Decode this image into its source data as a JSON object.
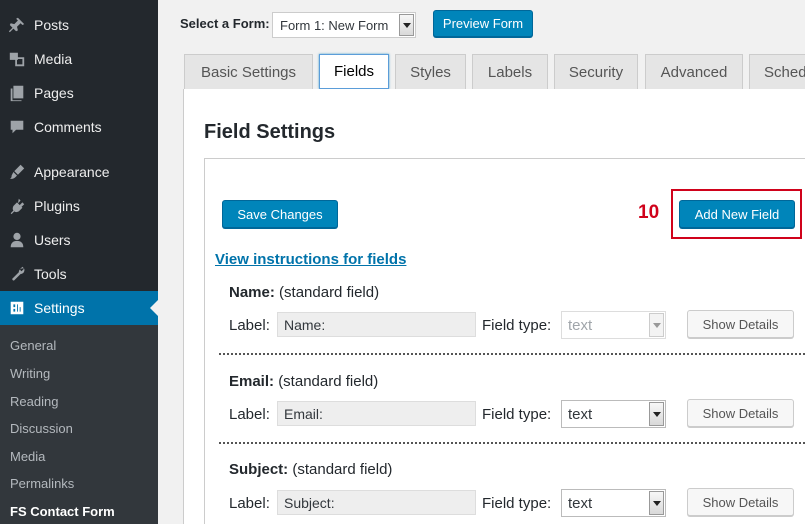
{
  "sidebar": {
    "menu": [
      {
        "label": "Posts",
        "icon": "pin-icon"
      },
      {
        "label": "Media",
        "icon": "media-icon"
      },
      {
        "label": "Pages",
        "icon": "pages-icon"
      },
      {
        "label": "Comments",
        "icon": "comment-icon"
      },
      {
        "label": "Appearance",
        "icon": "brush-icon"
      },
      {
        "label": "Plugins",
        "icon": "plugin-icon"
      },
      {
        "label": "Users",
        "icon": "user-icon"
      },
      {
        "label": "Tools",
        "icon": "wrench-icon"
      },
      {
        "label": "Settings",
        "icon": "settings-icon"
      }
    ],
    "submenu": [
      "General",
      "Writing",
      "Reading",
      "Discussion",
      "Media",
      "Permalinks",
      "FS Contact Form"
    ]
  },
  "toolbar": {
    "select_label": "Select a Form:",
    "selected_form": "Form 1: New Form",
    "preview_label": "Preview Form"
  },
  "tabs": [
    "Basic Settings",
    "Fields",
    "Styles",
    "Labels",
    "Security",
    "Advanced",
    "Sched"
  ],
  "main": {
    "title": "Field Settings",
    "save_label": "Save Changes",
    "step_number": "10",
    "add_field_label": "Add New Field",
    "instructions_link": "View instructions for fields",
    "label_text": "Label:",
    "field_type_text": "Field type:",
    "details_label": "Show Details",
    "fields": [
      {
        "name": "Name:",
        "kind": "(standard field)",
        "label_value": "Name:",
        "type": "text"
      },
      {
        "name": "Email:",
        "kind": "(standard field)",
        "label_value": "Email:",
        "type": "text"
      },
      {
        "name": "Subject:",
        "kind": "(standard field)",
        "label_value": "Subject:",
        "type": "text"
      }
    ]
  },
  "colors": {
    "sidebar": "#23282d",
    "accent": "#0073aa",
    "button": "#0085ba",
    "highlight": "#d0021b"
  }
}
